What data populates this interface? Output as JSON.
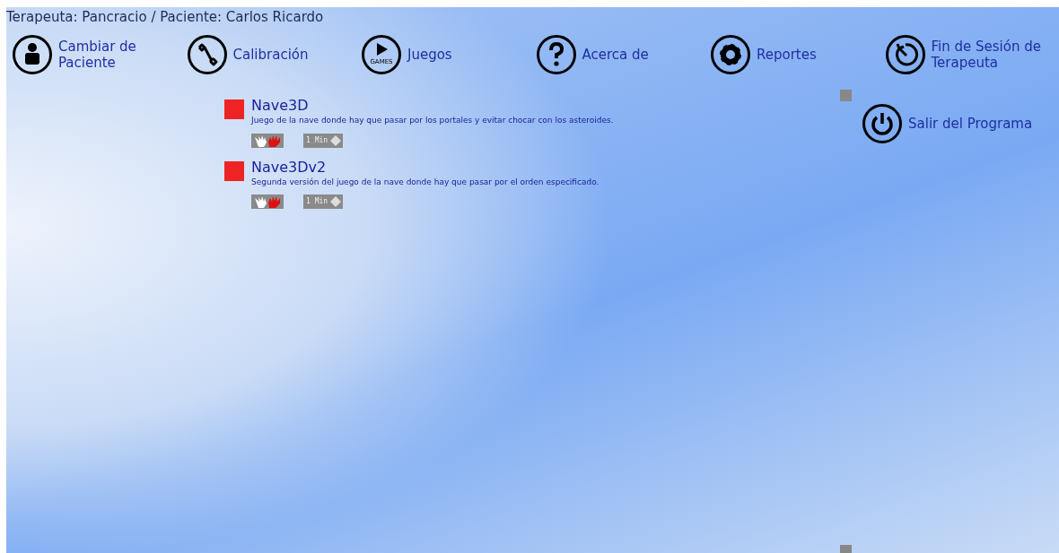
{
  "session_label": "Terapeuta: Pancracio / Paciente: Carlos Ricardo",
  "menu": [
    {
      "kind": "patient",
      "label": "Cambiar de Paciente"
    },
    {
      "kind": "tools",
      "label": "Calibración"
    },
    {
      "kind": "games",
      "label": "Juegos",
      "icon_text": "GAMES"
    },
    {
      "kind": "help",
      "label": "Acerca de"
    },
    {
      "kind": "settings",
      "label": "Reportes"
    },
    {
      "kind": "logout",
      "label": "Fin de Sesión de Terapeuta"
    }
  ],
  "games": [
    {
      "name": "Nave3D",
      "description": "Juego de la nave donde hay que pasar por los portales y evitar chocar con los asteroides.",
      "color": "#ee2424",
      "duration": "1 Min"
    },
    {
      "name": "Nave3Dv2",
      "description": "Segunda versión del juego de la nave donde hay que pasar por el orden especificado.",
      "color": "#ee2424",
      "duration": "1 Min"
    }
  ],
  "exit_button": {
    "label": "Salir del Programa"
  }
}
